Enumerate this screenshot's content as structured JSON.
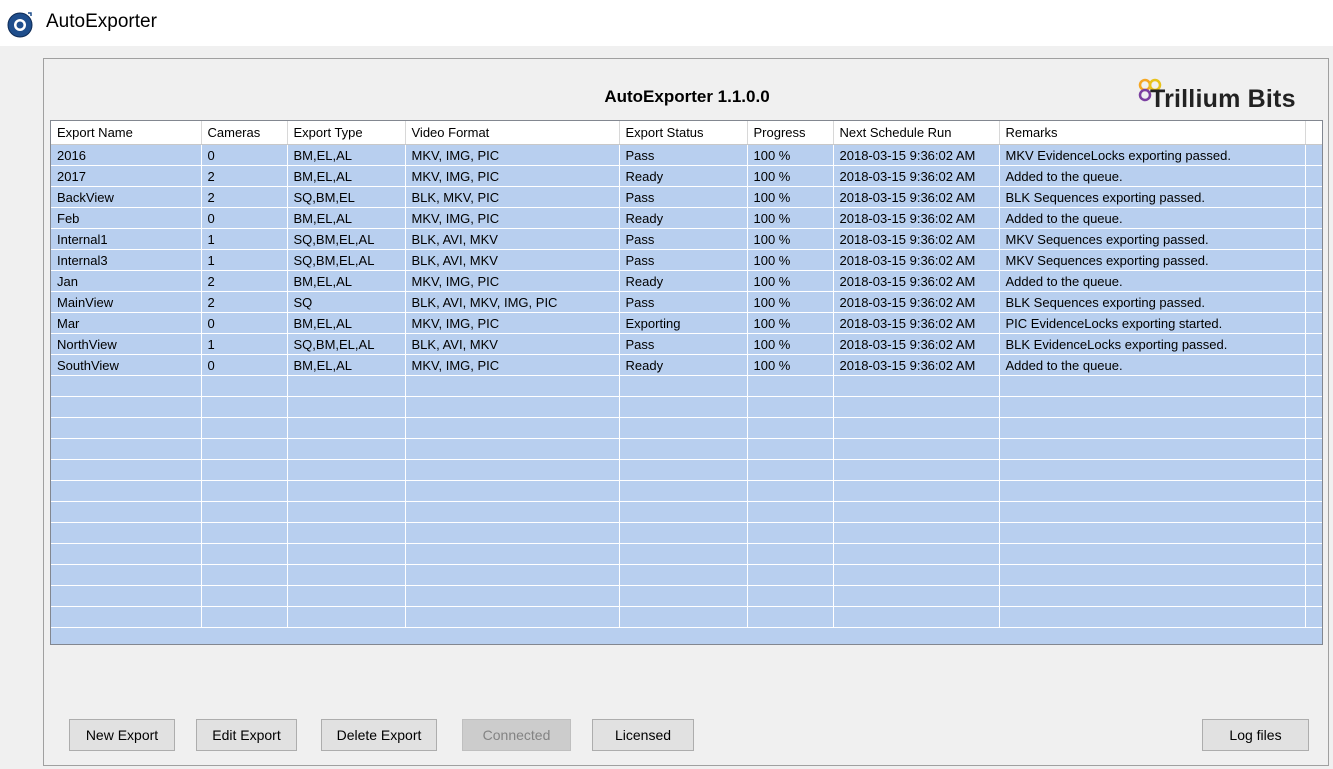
{
  "window": {
    "title": "AutoExporter"
  },
  "header": {
    "title": "AutoExporter 1.1.0.0",
    "brand": "Trillium Bits"
  },
  "table": {
    "columns": [
      "Export Name",
      "Cameras",
      "Export Type",
      "Video Format",
      "Export Status",
      "Progress",
      "Next Schedule Run",
      "Remarks"
    ],
    "rows": [
      [
        "2016",
        "0",
        "BM,EL,AL",
        " MKV, IMG, PIC",
        "Pass",
        "100 %",
        "2018-03-15 9:36:02 AM",
        "MKV EvidenceLocks exporting passed."
      ],
      [
        "2017",
        "2",
        "BM,EL,AL",
        " MKV, IMG, PIC",
        "Ready",
        "100 %",
        "2018-03-15 9:36:02 AM",
        "Added to the queue."
      ],
      [
        "BackView",
        "2",
        "SQ,BM,EL",
        "BLK, MKV, PIC",
        "Pass",
        "100 %",
        "2018-03-15 9:36:02 AM",
        "BLK Sequences exporting passed."
      ],
      [
        "Feb",
        "0",
        "BM,EL,AL",
        " MKV, IMG, PIC",
        "Ready",
        "100 %",
        "2018-03-15 9:36:02 AM",
        "Added to the queue."
      ],
      [
        "Internal1",
        "1",
        "SQ,BM,EL,AL",
        "BLK, AVI, MKV",
        "Pass",
        "100 %",
        "2018-03-15 9:36:02 AM",
        "MKV Sequences exporting passed."
      ],
      [
        "Internal3",
        "1",
        "SQ,BM,EL,AL",
        "BLK, AVI, MKV",
        "Pass",
        "100 %",
        "2018-03-15 9:36:02 AM",
        "MKV Sequences exporting passed."
      ],
      [
        "Jan",
        "2",
        "BM,EL,AL",
        " MKV, IMG, PIC",
        "Ready",
        "100 %",
        "2018-03-15 9:36:02 AM",
        "Added to the queue."
      ],
      [
        "MainView",
        "2",
        "SQ",
        "BLK, AVI, MKV, IMG, PIC",
        "Pass",
        "100 %",
        "2018-03-15 9:36:02 AM",
        "BLK Sequences exporting passed."
      ],
      [
        "Mar",
        "0",
        "BM,EL,AL",
        " MKV, IMG, PIC",
        "Exporting",
        "100 %",
        "2018-03-15 9:36:02 AM",
        "PIC EvidenceLocks exporting started."
      ],
      [
        "NorthView",
        "1",
        "SQ,BM,EL,AL",
        "BLK, AVI, MKV",
        "Pass",
        "100 %",
        "2018-03-15 9:36:02 AM",
        "BLK EvidenceLocks exporting passed."
      ],
      [
        "SouthView",
        "0",
        "BM,EL,AL",
        " MKV, IMG, PIC",
        "Ready",
        "100 %",
        "2018-03-15 9:36:02 AM",
        "Added to the queue."
      ]
    ],
    "empty_rows": 12
  },
  "buttons": {
    "new_export": "New Export",
    "edit_export": "Edit Export",
    "delete_export": "Delete Export",
    "connected": "Connected",
    "licensed": "Licensed",
    "log_files": "Log files"
  },
  "colors": {
    "row_background": "#b8cfef",
    "window_background": "#f0f0f0",
    "brand_orange": "#f5a623",
    "brand_purple": "#7b3fa0",
    "app_icon_blue": "#1f4e8c"
  },
  "icons": {
    "app": "app-camera-icon",
    "brand": "trillium-logo-icon"
  }
}
